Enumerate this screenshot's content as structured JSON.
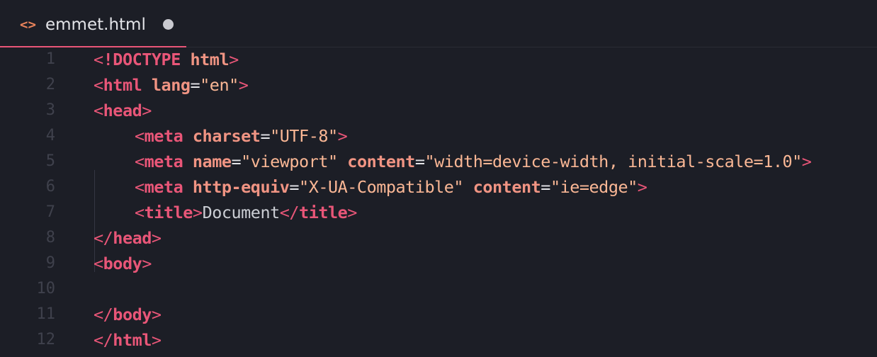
{
  "tab": {
    "icon": "code-icon",
    "icon_glyph": "<>",
    "label": "emmet.html",
    "unsaved": true
  },
  "colors": {
    "background": "#1c1e26",
    "tag": "#e95678",
    "attribute": "#f09483",
    "string": "#fab795",
    "text": "#cbced4",
    "line_number": "#3f414c",
    "tab_underline": "#e95678",
    "icon": "#e9835b"
  },
  "lines": [
    {
      "n": "1",
      "indent": 0,
      "tokens": [
        [
          "tag",
          "<"
        ],
        [
          "tagname",
          "!DOCTYPE"
        ],
        [
          "txt",
          " "
        ],
        [
          "attr",
          "html"
        ],
        [
          "tag",
          ">"
        ]
      ]
    },
    {
      "n": "2",
      "indent": 0,
      "tokens": [
        [
          "tag",
          "<"
        ],
        [
          "tagname",
          "html"
        ],
        [
          "txt",
          " "
        ],
        [
          "attr",
          "lang"
        ],
        [
          "eq",
          "="
        ],
        [
          "str",
          "\"en\""
        ],
        [
          "tag",
          ">"
        ]
      ]
    },
    {
      "n": "3",
      "indent": 0,
      "tokens": [
        [
          "tag",
          "<"
        ],
        [
          "tagname",
          "head"
        ],
        [
          "tag",
          ">"
        ]
      ]
    },
    {
      "n": "4",
      "indent": 1,
      "tokens": [
        [
          "tag",
          "<"
        ],
        [
          "tagname",
          "meta"
        ],
        [
          "txt",
          " "
        ],
        [
          "attr",
          "charset"
        ],
        [
          "eq",
          "="
        ],
        [
          "str",
          "\"UTF-8\""
        ],
        [
          "tag",
          ">"
        ]
      ]
    },
    {
      "n": "5",
      "indent": 1,
      "tokens": [
        [
          "tag",
          "<"
        ],
        [
          "tagname",
          "meta"
        ],
        [
          "txt",
          " "
        ],
        [
          "attr",
          "name"
        ],
        [
          "eq",
          "="
        ],
        [
          "str",
          "\"viewport\""
        ],
        [
          "txt",
          " "
        ],
        [
          "attr",
          "content"
        ],
        [
          "eq",
          "="
        ],
        [
          "str",
          "\"width=device-width, initial-scale=1.0\""
        ],
        [
          "tag",
          ">"
        ]
      ]
    },
    {
      "n": "6",
      "indent": 1,
      "tokens": [
        [
          "tag",
          "<"
        ],
        [
          "tagname",
          "meta"
        ],
        [
          "txt",
          " "
        ],
        [
          "attr",
          "http-equiv"
        ],
        [
          "eq",
          "="
        ],
        [
          "str",
          "\"X-UA-Compatible\""
        ],
        [
          "txt",
          " "
        ],
        [
          "attr",
          "content"
        ],
        [
          "eq",
          "="
        ],
        [
          "str",
          "\"ie=edge\""
        ],
        [
          "tag",
          ">"
        ]
      ]
    },
    {
      "n": "7",
      "indent": 1,
      "tokens": [
        [
          "tag",
          "<"
        ],
        [
          "tagname",
          "title"
        ],
        [
          "tag",
          ">"
        ],
        [
          "txt",
          "Document"
        ],
        [
          "tag",
          "</"
        ],
        [
          "tagname",
          "title"
        ],
        [
          "tag",
          ">"
        ]
      ]
    },
    {
      "n": "8",
      "indent": 0,
      "tokens": [
        [
          "tag",
          "</"
        ],
        [
          "tagname",
          "head"
        ],
        [
          "tag",
          ">"
        ]
      ]
    },
    {
      "n": "9",
      "indent": 0,
      "tokens": [
        [
          "tag",
          "<"
        ],
        [
          "tagname",
          "body"
        ],
        [
          "tag",
          ">"
        ]
      ]
    },
    {
      "n": "10",
      "indent": 0,
      "tokens": []
    },
    {
      "n": "11",
      "indent": 0,
      "tokens": [
        [
          "tag",
          "</"
        ],
        [
          "tagname",
          "body"
        ],
        [
          "tag",
          ">"
        ]
      ]
    },
    {
      "n": "12",
      "indent": 0,
      "tokens": [
        [
          "tag",
          "</"
        ],
        [
          "tagname",
          "html"
        ],
        [
          "tag",
          ">"
        ]
      ]
    }
  ]
}
